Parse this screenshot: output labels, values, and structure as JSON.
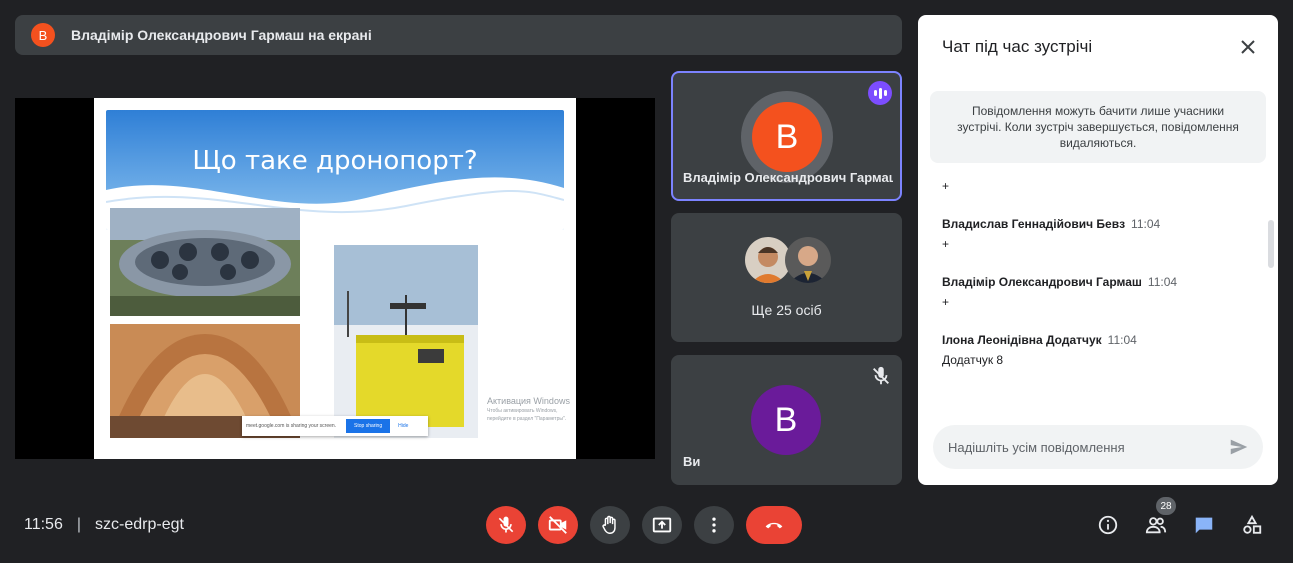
{
  "colors": {
    "background": "#202124",
    "tile": "#3c4043",
    "danger": "#ea4335",
    "presenter_avatar": "#f4511e",
    "you_avatar": "#6a1b9a",
    "speaking": "#7c4dff",
    "chat_active": "#8ab4f8"
  },
  "banner": {
    "avatar_letter": "В",
    "text": "Владімір Олександрович Гармаш на екрані"
  },
  "slide": {
    "title": "Що таке дронопорт?",
    "share_bar": {
      "text": "meet.google.com is sharing your screen.",
      "stop_label": "Stop sharing",
      "hide_label": "Hide"
    },
    "activation": {
      "title": "Активация Windows",
      "text": "Чтобы активировать Windows, перейдите в раздел \"Параметры\"."
    }
  },
  "tiles": {
    "presenter": {
      "avatar_letter": "В",
      "name": "Владімір Олександрович Гармаш"
    },
    "more": {
      "label": "Ще 25 осіб"
    },
    "you": {
      "avatar_letter": "В",
      "name": "Ви"
    }
  },
  "chat": {
    "title": "Чат під час зустрічі",
    "notice": "Повідомлення можуть бачити лише учасники зустрічі. Коли зустріч завершується, повідомлення видаляються.",
    "first_text": "+",
    "messages": [
      {
        "sender": "Владислав Геннадійович Бевз",
        "time": "11:04",
        "text": "+"
      },
      {
        "sender": "Владімір Олександрович Гармаш",
        "time": "11:04",
        "text": "+"
      },
      {
        "sender": "Ілона Леонідівна Додатчук",
        "time": "11:04",
        "text": "Додатчук 8"
      }
    ],
    "input_placeholder": "Надішліть усім повідомлення"
  },
  "meeting": {
    "time": "11:56",
    "separator": "|",
    "code": "szc-edrp-egt",
    "participants_count": "28"
  },
  "icons": {
    "mic": "mic-off-icon",
    "camera": "videocam-off-icon",
    "hand": "raise-hand-icon",
    "present": "present-screen-icon",
    "more": "more-vert-icon",
    "leave": "call-end-icon",
    "info": "info-icon",
    "people": "people-icon",
    "chat": "chat-icon",
    "activities": "activities-icon",
    "close": "close-icon",
    "send": "send-icon"
  }
}
